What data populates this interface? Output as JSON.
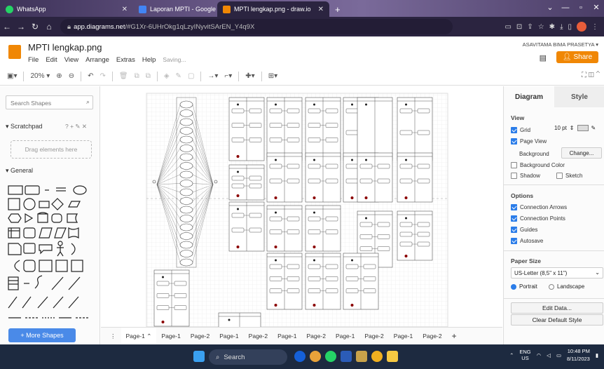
{
  "browser": {
    "tabs": [
      {
        "title": "WhatsApp",
        "icon": "whatsapp-icon",
        "color": "#25d366"
      },
      {
        "title": "Laporan MPTI - Google Dokume",
        "icon": "google-docs-icon",
        "color": "#4285f4"
      },
      {
        "title": "MPTI lengkap.png - draw.io",
        "icon": "drawio-icon",
        "color": "#f08705"
      }
    ],
    "url_host": "app.diagrams.net",
    "url_rest": "/#G1Xr-6UHrOkg1qLzyINyvitSArEN_Y4q9X"
  },
  "app": {
    "doc_title": "MPTI lengkap.png",
    "menu": [
      "File",
      "Edit",
      "View",
      "Arrange",
      "Extras",
      "Help"
    ],
    "saving": "Saving...",
    "user": "ASAVITAMA BIMA PRASETYA",
    "share": "Share"
  },
  "toolbar": {
    "zoom": "20%"
  },
  "left": {
    "search_placeholder": "Search Shapes",
    "scratchpad": "Scratchpad",
    "drag_here": "Drag elements here",
    "general": "General",
    "more_shapes": "+ More Shapes"
  },
  "pages": [
    "Page-1",
    "Page-1",
    "Page-2",
    "Page-1",
    "Page-2",
    "Page-1",
    "Page-2",
    "Page-1",
    "Page-2",
    "Page-1",
    "Page-2"
  ],
  "right": {
    "tab_diagram": "Diagram",
    "tab_style": "Style",
    "view": "View",
    "grid": "Grid",
    "grid_size": "10 pt",
    "page_view": "Page View",
    "background": "Background",
    "change": "Change...",
    "background_color": "Background Color",
    "shadow": "Shadow",
    "sketch": "Sketch",
    "options": "Options",
    "connection_arrows": "Connection Arrows",
    "connection_points": "Connection Points",
    "guides": "Guides",
    "autosave": "Autosave",
    "paper_size": "Paper Size",
    "paper_value": "US-Letter (8,5\" x 11\")",
    "portrait": "Portrait",
    "landscape": "Landscape",
    "edit_data": "Edit Data...",
    "clear_style": "Clear Default Style"
  },
  "taskbar": {
    "search": "Search",
    "lang": "ENG",
    "region": "US",
    "time": "10:48 PM",
    "date": "8/11/2023"
  }
}
